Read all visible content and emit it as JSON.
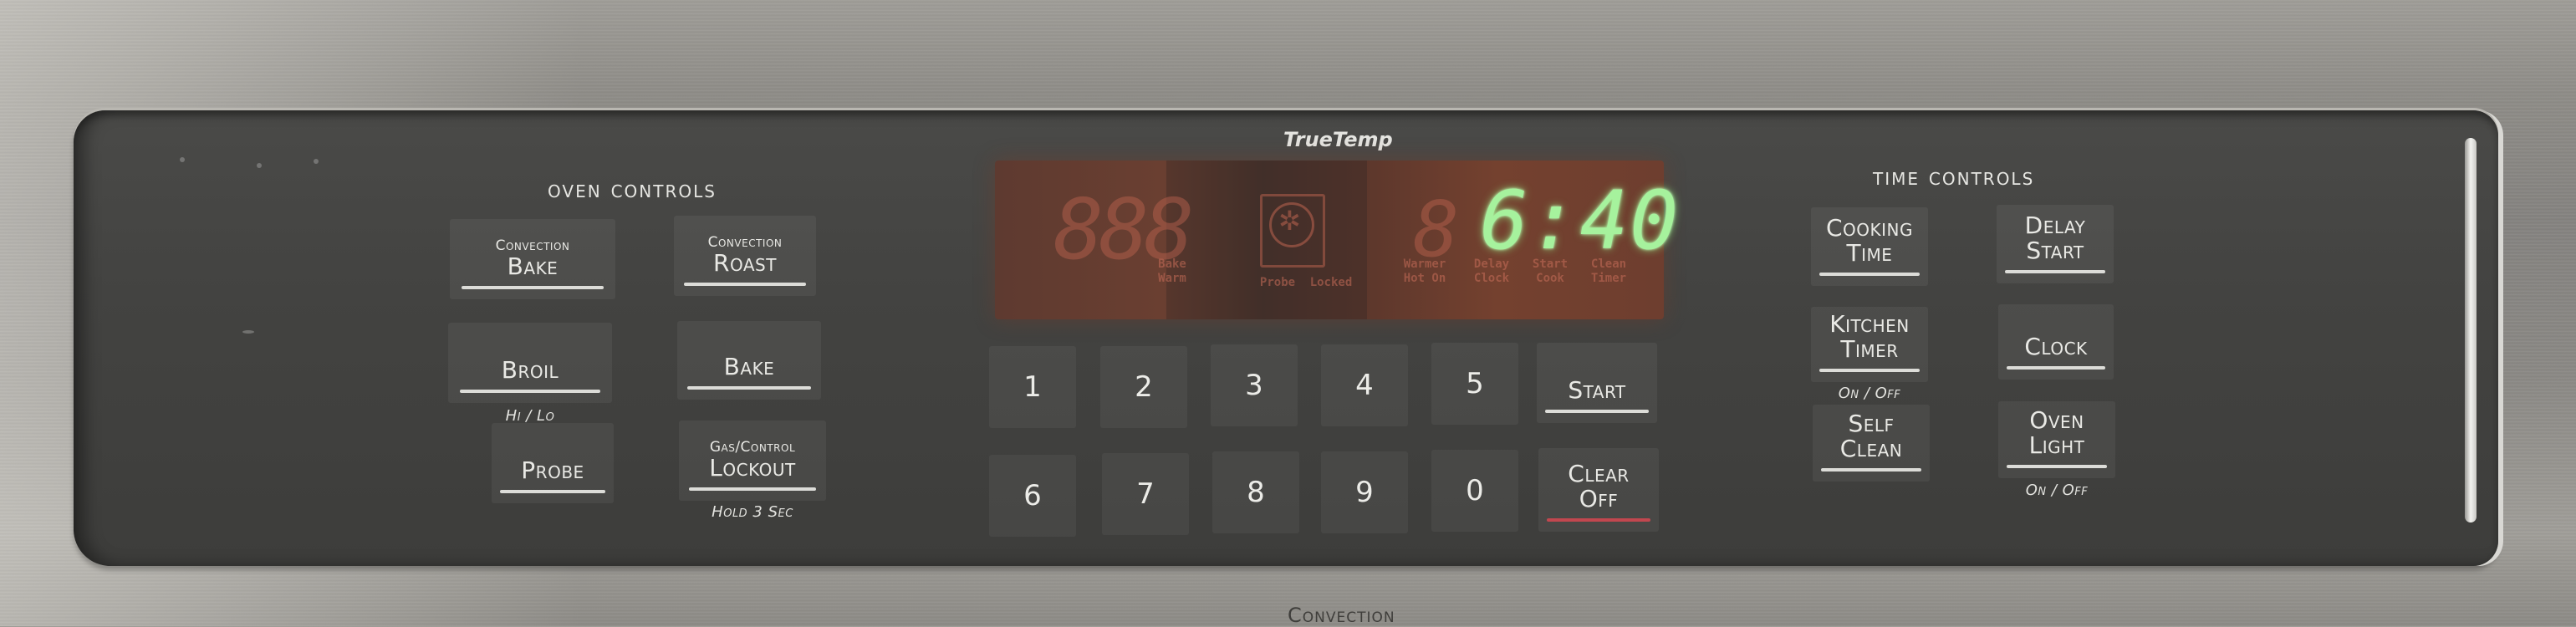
{
  "branding": {
    "logo": "TrueTemp",
    "bottom_label": "Convection"
  },
  "oven_controls": {
    "heading": "Oven Controls",
    "buttons": [
      {
        "small": "Convection",
        "main": "Bake"
      },
      {
        "small": "Convection",
        "main": "Roast"
      },
      {
        "small": "",
        "main": "Broil",
        "sub": "Hi / Lo"
      },
      {
        "small": "",
        "main": "Bake"
      },
      {
        "small": "",
        "main": "Probe"
      },
      {
        "small": "Gas/Control",
        "main": "Lockout",
        "sub": "Hold 3 Sec"
      }
    ]
  },
  "display": {
    "clock": "6:40",
    "clock_color": "#a6f29d",
    "temp_ghost": "888",
    "ghost_color": "#be6450",
    "labels_left": [
      "Bake",
      "Warm"
    ],
    "labels_center": [
      "Probe",
      "Locked"
    ],
    "labels_right": [
      {
        "line1": "Warmer",
        "line2": "Hot On"
      },
      {
        "line1": "Delay",
        "line2": "Clock"
      },
      {
        "line1": "Start",
        "line2": "Cook"
      },
      {
        "line1": "Clean",
        "line2": "Timer"
      }
    ],
    "icon": "convection-fan-icon"
  },
  "keypad": {
    "keys": [
      "1",
      "2",
      "3",
      "4",
      "5",
      "6",
      "7",
      "8",
      "9",
      "0"
    ],
    "start": "Start",
    "clear_line1": "Clear",
    "clear_line2": "Off",
    "clear_accent": "#c2474f"
  },
  "time_controls": {
    "heading": "Time Controls",
    "buttons": [
      {
        "line1": "Cooking",
        "line2": "Time"
      },
      {
        "line1": "Delay",
        "line2": "Start"
      },
      {
        "line1": "Kitchen",
        "line2": "Timer",
        "sub": "On / Off"
      },
      {
        "line1": "",
        "line2": "Clock"
      },
      {
        "line1": "Self",
        "line2": "Clean"
      },
      {
        "line1": "Oven",
        "line2": "Light",
        "sub": "On / Off"
      }
    ]
  }
}
